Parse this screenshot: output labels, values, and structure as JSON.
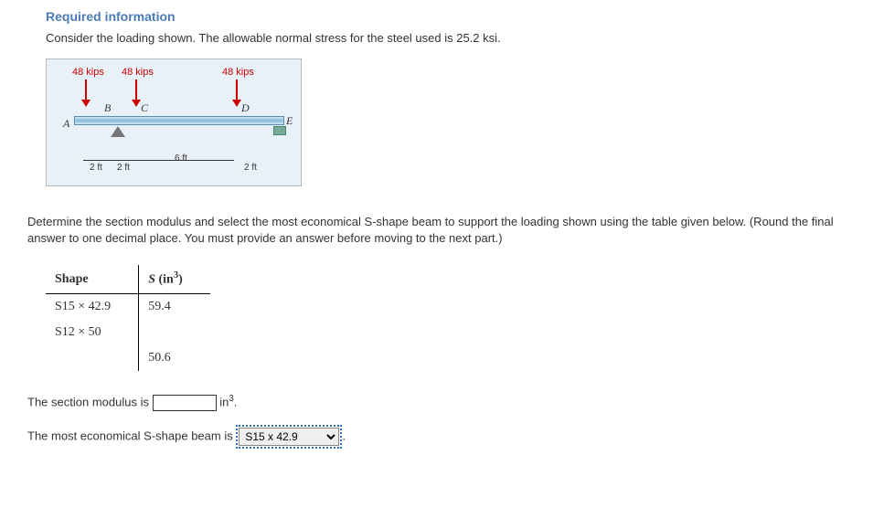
{
  "header": "Required information",
  "intro": "Consider the loading shown. The allowable normal stress for the steel used is 25.2 ksi.",
  "figure": {
    "loads": [
      "48 kips",
      "48 kips",
      "48 kips"
    ],
    "points": {
      "A": "A",
      "B": "B",
      "C": "C",
      "D": "D",
      "E": "E"
    },
    "dims": {
      "d1": "2 ft",
      "d2": "2 ft",
      "d3": "6 ft",
      "d4": "2 ft"
    }
  },
  "question": "Determine the section modulus and select the most economical S-shape beam to support the loading shown using the table given below. (Round the final answer to one decimal place. You must provide an answer before moving to the next part.)",
  "table": {
    "headers": {
      "shape": "Shape",
      "s_html": "S (in³)"
    },
    "rows": [
      {
        "shape": "S15 × 42.9",
        "s": "59.4"
      },
      {
        "shape": "S12 × 50",
        "s": ""
      }
    ],
    "extra_row_s": "50.6"
  },
  "answers": {
    "label1_pre": "The section modulus is ",
    "unit1": "in",
    "unit1_sup": "3",
    "label2_pre": "The most economical S-shape beam is",
    "select_value": "S15 x 42.9",
    "options": [
      "S15 x 42.9",
      "S12 x 50"
    ]
  }
}
